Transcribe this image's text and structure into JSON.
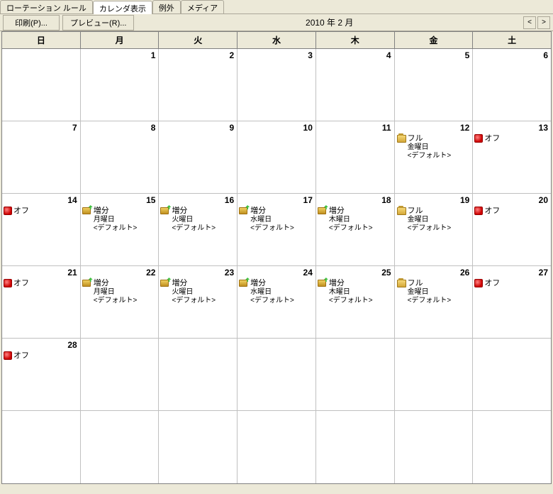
{
  "tabs": [
    {
      "label": "ローテーション ルール",
      "active": false
    },
    {
      "label": "カレンダ表示",
      "active": true
    },
    {
      "label": "例外",
      "active": false
    },
    {
      "label": "メディア",
      "active": false
    }
  ],
  "toolbar": {
    "print": "印刷(P)...",
    "preview": "プレビュー(R)...",
    "title": "2010 年 2 月",
    "prev": "<",
    "next": ">"
  },
  "weekdays": [
    "日",
    "月",
    "火",
    "水",
    "木",
    "金",
    "土"
  ],
  "entry_types": {
    "off": {
      "label": "オフ",
      "icon": "off"
    },
    "inc_mon": {
      "label": "増分",
      "sub1": "月曜日",
      "sub2": "<デフォルト>",
      "icon": "inc"
    },
    "inc_tue": {
      "label": "増分",
      "sub1": "火曜日",
      "sub2": "<デフォルト>",
      "icon": "inc"
    },
    "inc_wed": {
      "label": "増分",
      "sub1": "水曜日",
      "sub2": "<デフォルト>",
      "icon": "inc"
    },
    "inc_thu": {
      "label": "増分",
      "sub1": "木曜日",
      "sub2": "<デフォルト>",
      "icon": "inc"
    },
    "full": {
      "label": "フル",
      "sub1": "金曜日",
      "sub2": "<デフォルト>",
      "icon": "full"
    }
  },
  "weeks": [
    [
      {
        "day": "",
        "entry": null
      },
      {
        "day": "1",
        "entry": null
      },
      {
        "day": "2",
        "entry": null
      },
      {
        "day": "3",
        "entry": null
      },
      {
        "day": "4",
        "entry": null
      },
      {
        "day": "5",
        "entry": null
      },
      {
        "day": "6",
        "entry": null
      }
    ],
    [
      {
        "day": "7",
        "entry": null
      },
      {
        "day": "8",
        "entry": null
      },
      {
        "day": "9",
        "entry": null
      },
      {
        "day": "10",
        "entry": null
      },
      {
        "day": "11",
        "entry": null
      },
      {
        "day": "12",
        "entry": "full"
      },
      {
        "day": "13",
        "entry": "off"
      }
    ],
    [
      {
        "day": "14",
        "entry": "off"
      },
      {
        "day": "15",
        "entry": "inc_mon"
      },
      {
        "day": "16",
        "entry": "inc_tue"
      },
      {
        "day": "17",
        "entry": "inc_wed"
      },
      {
        "day": "18",
        "entry": "inc_thu"
      },
      {
        "day": "19",
        "entry": "full"
      },
      {
        "day": "20",
        "entry": "off"
      }
    ],
    [
      {
        "day": "21",
        "entry": "off"
      },
      {
        "day": "22",
        "entry": "inc_mon"
      },
      {
        "day": "23",
        "entry": "inc_tue"
      },
      {
        "day": "24",
        "entry": "inc_wed"
      },
      {
        "day": "25",
        "entry": "inc_thu"
      },
      {
        "day": "26",
        "entry": "full"
      },
      {
        "day": "27",
        "entry": "off"
      }
    ],
    [
      {
        "day": "28",
        "entry": "off"
      },
      {
        "day": "",
        "entry": null
      },
      {
        "day": "",
        "entry": null
      },
      {
        "day": "",
        "entry": null
      },
      {
        "day": "",
        "entry": null
      },
      {
        "day": "",
        "entry": null
      },
      {
        "day": "",
        "entry": null
      }
    ],
    [
      {
        "day": "",
        "entry": null
      },
      {
        "day": "",
        "entry": null
      },
      {
        "day": "",
        "entry": null
      },
      {
        "day": "",
        "entry": null
      },
      {
        "day": "",
        "entry": null
      },
      {
        "day": "",
        "entry": null
      },
      {
        "day": "",
        "entry": null
      }
    ]
  ]
}
